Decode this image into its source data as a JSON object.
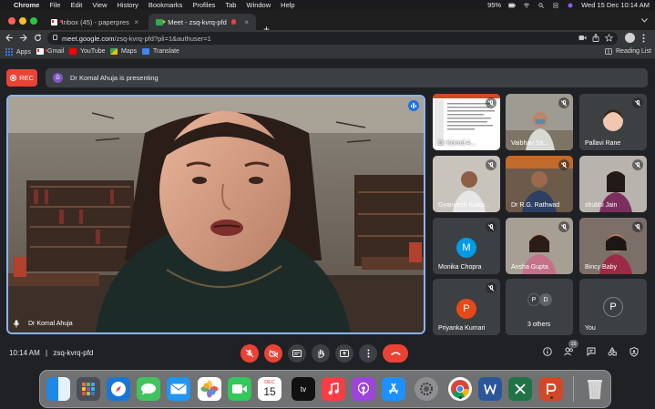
{
  "menubar": {
    "app": "Chrome",
    "menus": [
      "File",
      "Edit",
      "View",
      "History",
      "Bookmarks",
      "Profiles",
      "Tab",
      "Window",
      "Help"
    ],
    "battery": "95%",
    "datetime": "Wed 15 Dec  10:14 AM"
  },
  "browser": {
    "tabs": [
      {
        "title": "Inbox (45) - paperpresentation",
        "close": "×"
      },
      {
        "title": "Meet - zsq-kvrq-pfd",
        "close": "×"
      }
    ],
    "new_tab": "+",
    "url_host": "meet.google.com",
    "url_path": "/zsq-kvrq-pfd?pli=1&authuser=1",
    "bookmarks": [
      "Apps",
      "Gmail",
      "YouTube",
      "Maps",
      "Translate"
    ],
    "reading_list": "Reading List"
  },
  "meet": {
    "rec_label": "REC",
    "presenter_initial": "D",
    "presenting_text": "Dr Komal Ahuja is presenting",
    "main_speaker": "Dr Komal Ahuja",
    "participants": [
      {
        "name": "Dr Komal A...",
        "kind": "screen"
      },
      {
        "name": "Vaibhav Sa...",
        "kind": "video"
      },
      {
        "name": "Pallavi Rane",
        "kind": "video"
      },
      {
        "name": "Gyanyesh Kulka...",
        "kind": "video"
      },
      {
        "name": "Dr R.G. Rathwad",
        "kind": "video"
      },
      {
        "name": "shubhi Jain",
        "kind": "video"
      },
      {
        "name": "Monika Chopra",
        "kind": "avatar",
        "initial": "M",
        "color": "#039be5"
      },
      {
        "name": "Ansha Gupta",
        "kind": "video"
      },
      {
        "name": "Bincy Baby",
        "kind": "video"
      },
      {
        "name": "Priyanka Kumari",
        "kind": "avatar",
        "initial": "P",
        "color": "#e64a19"
      },
      {
        "name": "3 others",
        "kind": "others",
        "initials": [
          "P",
          "D"
        ]
      },
      {
        "name": "You",
        "kind": "avatar",
        "initial": "P",
        "color": "#3c4043"
      }
    ],
    "time": "10:14 AM",
    "separator": "|",
    "meeting_code": "zsq-kvrq-pfd",
    "participant_count": "15"
  },
  "dock": {
    "calendar_month": "DEC",
    "calendar_day": "15",
    "tv_label": "tv"
  },
  "colors": {
    "accent_blue": "#8ab4f8",
    "danger_red": "#ea4335",
    "surface": "#3c4043",
    "background": "#202124"
  }
}
